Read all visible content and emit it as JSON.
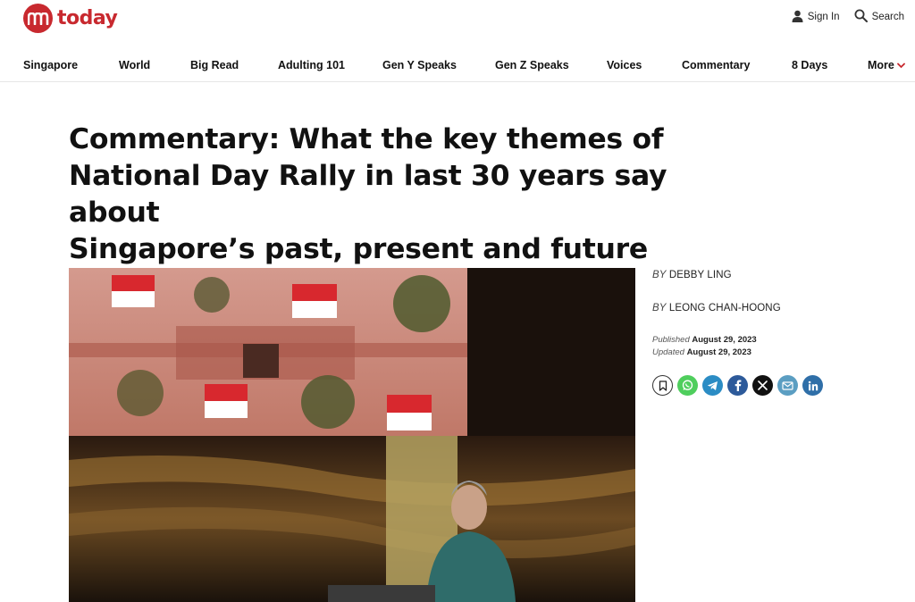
{
  "brand": {
    "name": "today",
    "color": "#c8292f"
  },
  "header": {
    "sign_in": "Sign In",
    "search": "Search",
    "icons": {
      "sign_in": "person-icon",
      "search": "search-icon"
    }
  },
  "nav": {
    "items": [
      "Singapore",
      "World",
      "Big Read",
      "Adulting 101",
      "Gen Y Speaks",
      "Gen Z Speaks",
      "Voices",
      "Commentary",
      "8 Days"
    ],
    "more": "More",
    "more_icon": "chevron-down-icon"
  },
  "article": {
    "headline_lines": [
      "Commentary: What the key themes of",
      "National Day Rally in last 30 years say about",
      "Singapore’s past, present and future"
    ],
    "by_prefix": "BY",
    "authors": [
      "DEBBY LING",
      "LEONG CHAN-HOONG"
    ],
    "published_label": "Published",
    "published_date": "August 29, 2023",
    "updated_label": "Updated",
    "updated_date": "August 29, 2023",
    "share_icons": [
      "bookmark-icon",
      "whatsapp-icon",
      "telegram-icon",
      "facebook-icon",
      "x-icon",
      "email-icon",
      "linkedin-icon"
    ],
    "share_colors": [
      "#ffffff",
      "#4fce5d",
      "#2b8cc4",
      "#2d5a9a",
      "#111111",
      "#5b9ec2",
      "#2f6fa8"
    ]
  }
}
